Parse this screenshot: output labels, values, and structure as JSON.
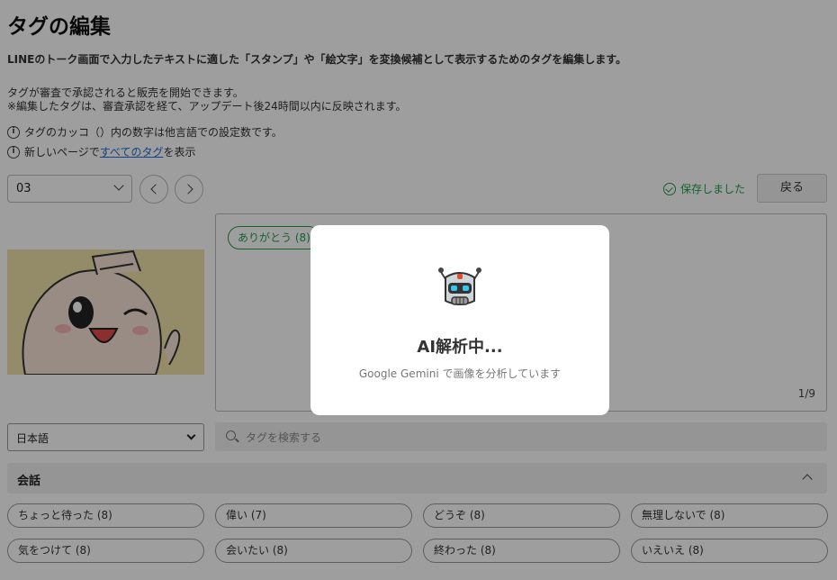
{
  "page": {
    "title": "タグの編集",
    "description": "LINEのトーク画面で入力したテキストに適した「スタンプ」や「絵文字」を変換候補として表示するためのタグを編集します。",
    "note1": "タグが審査で承認されると販売を開始できます。",
    "note2": "※編集したタグは、審査承認を経て、アップデート後24時間以内に反映されます。",
    "info1": "タグのカッコ（）内の数字は他言語での設定数です。",
    "info2_prefix": "新しいページで",
    "info2_link": "すべてのタグ",
    "info2_suffix": "を表示"
  },
  "controls": {
    "sticker_select": "03",
    "saved_status": "保存しました",
    "back_button": "戻る",
    "language_select": "日本語",
    "search_placeholder": "タグを検索する"
  },
  "tag_area": {
    "selected_tag": "ありがとう (8)",
    "count": "1/9"
  },
  "section": {
    "title": "会話"
  },
  "chips": [
    "ちょっと待った (8)",
    "偉い (7)",
    "どうぞ (8)",
    "無理しないで (8)",
    "気をつけて (8)",
    "会いたい (8)",
    "終わった (8)",
    "いえいえ (8)"
  ],
  "modal": {
    "title": "AI解析中...",
    "subtitle": "Google Gemini で画像を分析しています"
  },
  "colors": {
    "accent_green": "#21a04a",
    "link_blue": "#1a6dd8",
    "overlay": "rgba(0,0,0,0.38)"
  },
  "icons": {
    "info": "info-icon",
    "saved": "check-circle-icon",
    "search": "search-icon",
    "modal": "robot-icon"
  }
}
